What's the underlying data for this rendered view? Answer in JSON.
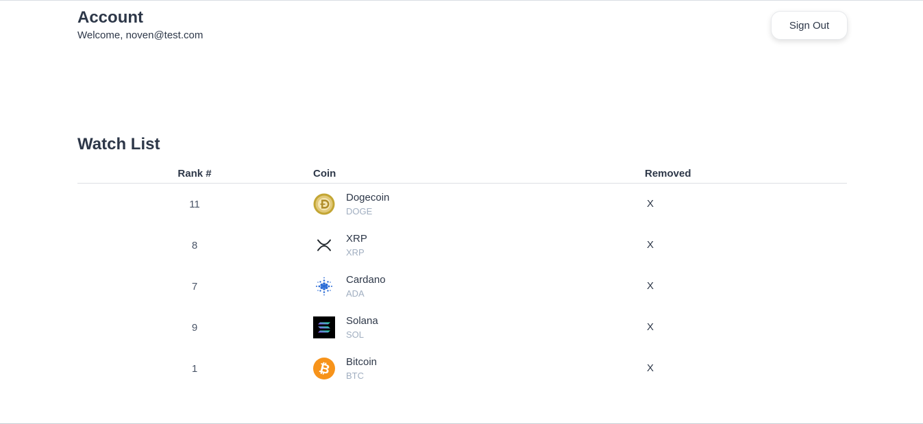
{
  "account": {
    "title": "Account",
    "welcome": "Welcome, noven@test.com",
    "sign_out_label": "Sign Out"
  },
  "watchlist": {
    "title": "Watch List",
    "columns": {
      "rank": "Rank #",
      "coin": "Coin",
      "removed": "Removed"
    },
    "remove_label": "X",
    "rows": [
      {
        "rank": "11",
        "name": "Dogecoin",
        "symbol": "DOGE",
        "icon": "dogecoin-icon"
      },
      {
        "rank": "8",
        "name": "XRP",
        "symbol": "XRP",
        "icon": "xrp-icon"
      },
      {
        "rank": "7",
        "name": "Cardano",
        "symbol": "ADA",
        "icon": "cardano-icon"
      },
      {
        "rank": "9",
        "name": "Solana",
        "symbol": "SOL",
        "icon": "solana-icon"
      },
      {
        "rank": "1",
        "name": "Bitcoin",
        "symbol": "BTC",
        "icon": "bitcoin-icon"
      }
    ]
  },
  "colors": {
    "text": "#2d3748",
    "muted": "#a0aec0",
    "bitcoin": "#f7931a",
    "cardano": "#2b6cd6",
    "dogecoin": "#c3a634"
  }
}
